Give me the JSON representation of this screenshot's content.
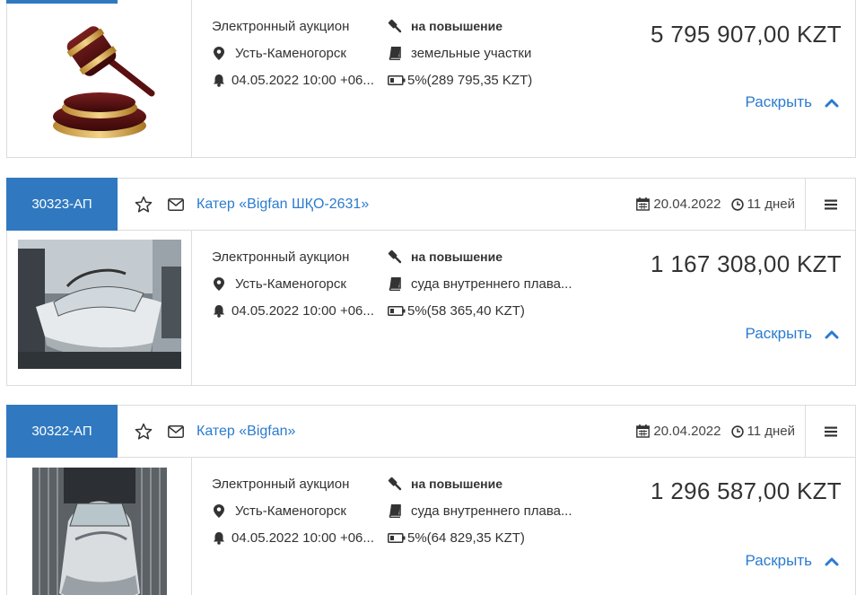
{
  "lots": [
    {
      "badge": "",
      "title": "",
      "date": "",
      "days": "",
      "auction_type": "Электронный аукцион",
      "direction": "на повышение",
      "city": "Усть-Каменогорск",
      "category": "земельные участки",
      "start": "04.05.2022 10:00 +06...",
      "deposit": "5%(289 795,35 KZT)",
      "price": "5 795 907,00 KZT",
      "expand_label": "Раскрыть",
      "image": "gavel"
    },
    {
      "badge": "30323-АП",
      "title": "Катер «Bigfan ШҚО-2631»",
      "date": "20.04.2022",
      "days": "11 дней",
      "auction_type": "Электронный аукцион",
      "direction": "на повышение",
      "city": "Усть-Каменогорск",
      "category": "суда внутреннего плава...",
      "start": "04.05.2022 10:00 +06...",
      "deposit": "5%(58 365,40 KZT)",
      "price": "1 167 308,00 KZT",
      "expand_label": "Раскрыть",
      "image": "boat-photo"
    },
    {
      "badge": "30322-АП",
      "title": "Катер «Bigfan»",
      "date": "20.04.2022",
      "days": "11 дней",
      "auction_type": "Электронный аукцион",
      "direction": "на повышение",
      "city": "Усть-Каменогорск",
      "category": "суда внутреннего плава...",
      "start": "04.05.2022 10:00 +06...",
      "deposit": "5%(64 829,35 KZT)",
      "price": "1 296 587,00 KZT",
      "expand_label": "Раскрыть",
      "image": "boat-photo-2"
    }
  ],
  "colors": {
    "accent": "#3079c0",
    "link": "#2b7bd0",
    "border": "#dcdcdc"
  }
}
